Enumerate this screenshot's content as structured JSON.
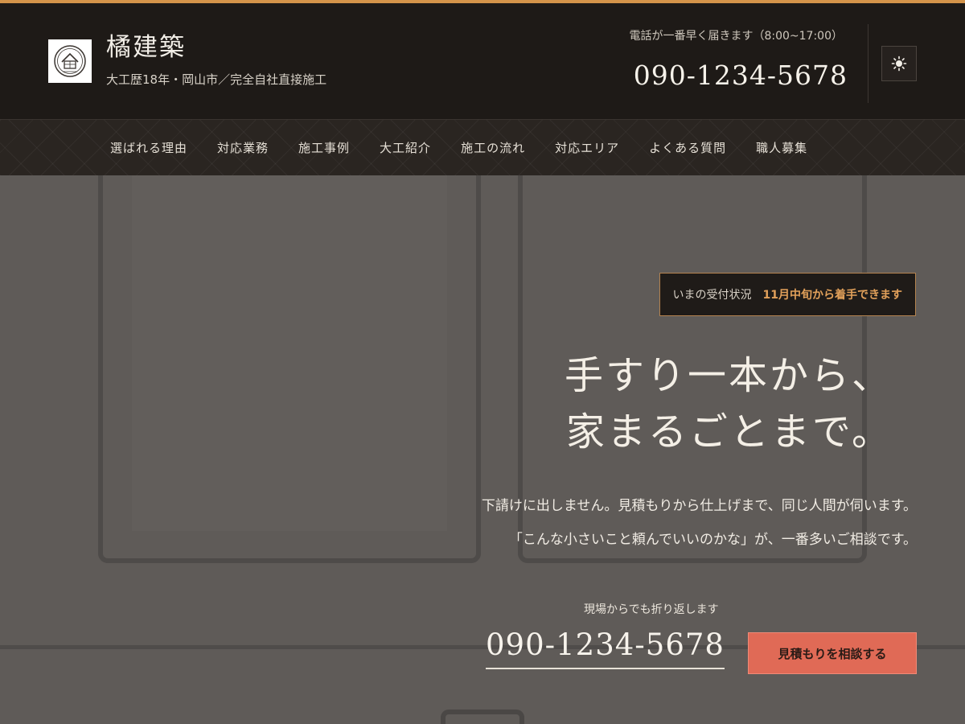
{
  "header": {
    "title": "橘建築",
    "tagline": "大工歴18年・岡山市／完全自社直接施工",
    "note": "電話が一番早く届きます（8:00~17:00）",
    "phone": "090-1234-5678",
    "theme_icon": "sun-icon",
    "logo_icon": "house-emblem-icon"
  },
  "nav": {
    "items": [
      {
        "label": "選ばれる理由"
      },
      {
        "label": "対応業務"
      },
      {
        "label": "施工事例"
      },
      {
        "label": "大工紹介"
      },
      {
        "label": "施工の流れ"
      },
      {
        "label": "対応エリア"
      },
      {
        "label": "よくある質問"
      },
      {
        "label": "職人募集"
      }
    ]
  },
  "hero": {
    "status_label": "いまの受付状況",
    "status_value": "11月中旬から着手できます",
    "headline_line1": "手すり一本から、",
    "headline_line2": "家まるごとまで。",
    "lead_line1": "下請けに出しません。見積もりから仕上げまで、同じ人間が伺います。",
    "lead_line2": "「こんな小さいこと頼んでいいのかな」が、一番多いご相談です。",
    "cta_note": "現場からでも折り返します",
    "cta_phone": "090-1234-5678",
    "cta_button": "見積もりを相談する"
  },
  "colors": {
    "accent_orange": "#d4944a",
    "header_bg": "#1e1a17",
    "cta_button_bg": "#e06a56",
    "status_value": "#e1a05a",
    "hero_bg": "#5f5b58"
  }
}
